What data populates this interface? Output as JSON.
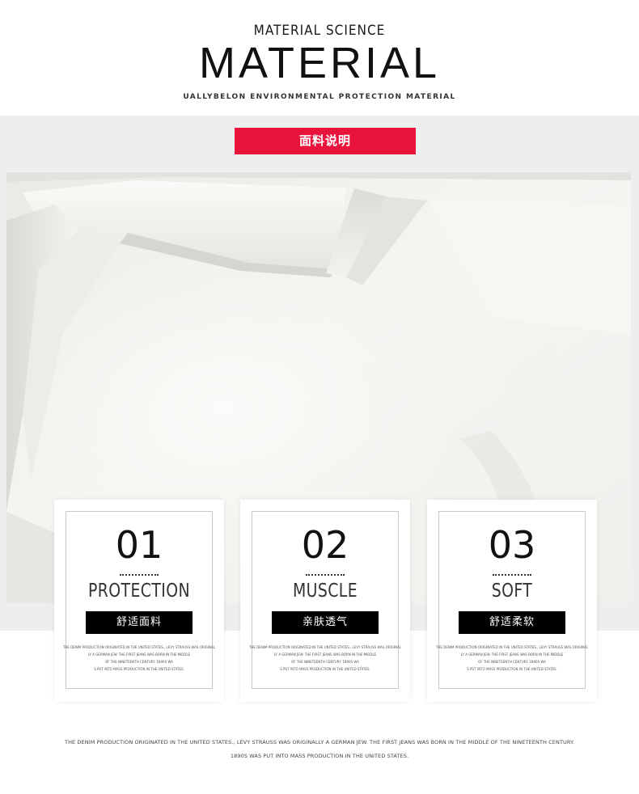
{
  "header": {
    "subtitle_top": "MATERIAL SCIENCE",
    "title": "MATERIAL",
    "subtitle_bottom": "UALLYBELON ENVIRONMENTAL PROTECTION MATERIAL"
  },
  "banner": {
    "label": "面料说明",
    "color": "#e8143c"
  },
  "fabric_image": {
    "icon": "fabric-photo"
  },
  "cards": [
    {
      "number": "01",
      "title": "PROTECTION",
      "tag": "舒适面料",
      "desc_lines": [
        "THE DENIM PRODUCTION ORIGINATED IN THE UNITED STATES., LEVY STRAUSS WAS ORIGINAL",
        "LY A GERMAN JEW. THE FIRST JEANS WAS BORN IN THE MIDDLE",
        "OF THE NINETEENTH CENTURY. 1890S WA",
        "S PUT INTO MASS PRODUCTION IN THE UNITED STATES."
      ]
    },
    {
      "number": "02",
      "title": "MUSCLE",
      "tag": "亲肤透气",
      "desc_lines": [
        "THE DENIM PRODUCTION ORIGINATED IN THE UNITED STATES., LEVY STRAUSS WAS ORIGINAL",
        "LY A GERMAN JEW. THE FIRST JEANS WAS BORN IN THE MIDDLE",
        "OF THE NINETEENTH CENTURY. 1890S WA",
        "S PUT INTO MASS PRODUCTION IN THE UNITED STATES."
      ]
    },
    {
      "number": "03",
      "title": "SOFT",
      "tag": "舒适柔软",
      "desc_lines": [
        "THE DENIM PRODUCTION ORIGINATED IN THE UNITED STATES., LEVY STRAUSS WAS ORIGINAL",
        "LY A GERMAN JEW. THE FIRST JEANS WAS BORN IN THE MIDDLE",
        "OF THE NINETEENTH CENTURY. 1890S WA",
        "S PUT INTO MASS PRODUCTION IN THE UNITED STATES."
      ]
    }
  ],
  "footer": {
    "line1": "THE DENIM PRODUCTION ORIGINATED IN THE UNITED STATES., LEVY STRAUSS WAS ORIGINALLY A GERMAN JEW. THE FIRST JEANS WAS BORN IN THE MIDDLE OF THE NINETEENTH CENTURY.",
    "line2": "1890S WAS PUT INTO MASS PRODUCTION IN THE UNITED STATES."
  }
}
